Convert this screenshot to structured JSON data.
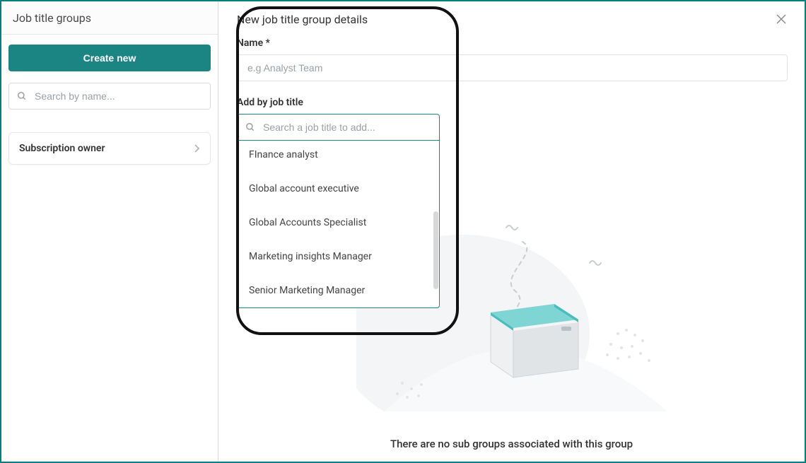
{
  "sidebar": {
    "title": "Job title groups",
    "create_label": "Create new",
    "search_placeholder": "Search by name...",
    "groups": [
      {
        "label": "Subscription owner"
      }
    ]
  },
  "detail": {
    "title": "New job title group details",
    "name_label": "Name *",
    "name_placeholder": "e.g Analyst Team",
    "add_label": "Add by job title",
    "job_search_placeholder": "Search a job title to add...",
    "job_options": [
      "FInance analyst",
      "Global account executive",
      "Global Accounts Specialist",
      "Marketing insights Manager",
      "Senior Marketing Manager"
    ]
  },
  "empty_state": {
    "message": "There are no sub groups associated with this group"
  },
  "colors": {
    "accent": "#1b8584",
    "app_border": "#008080"
  }
}
